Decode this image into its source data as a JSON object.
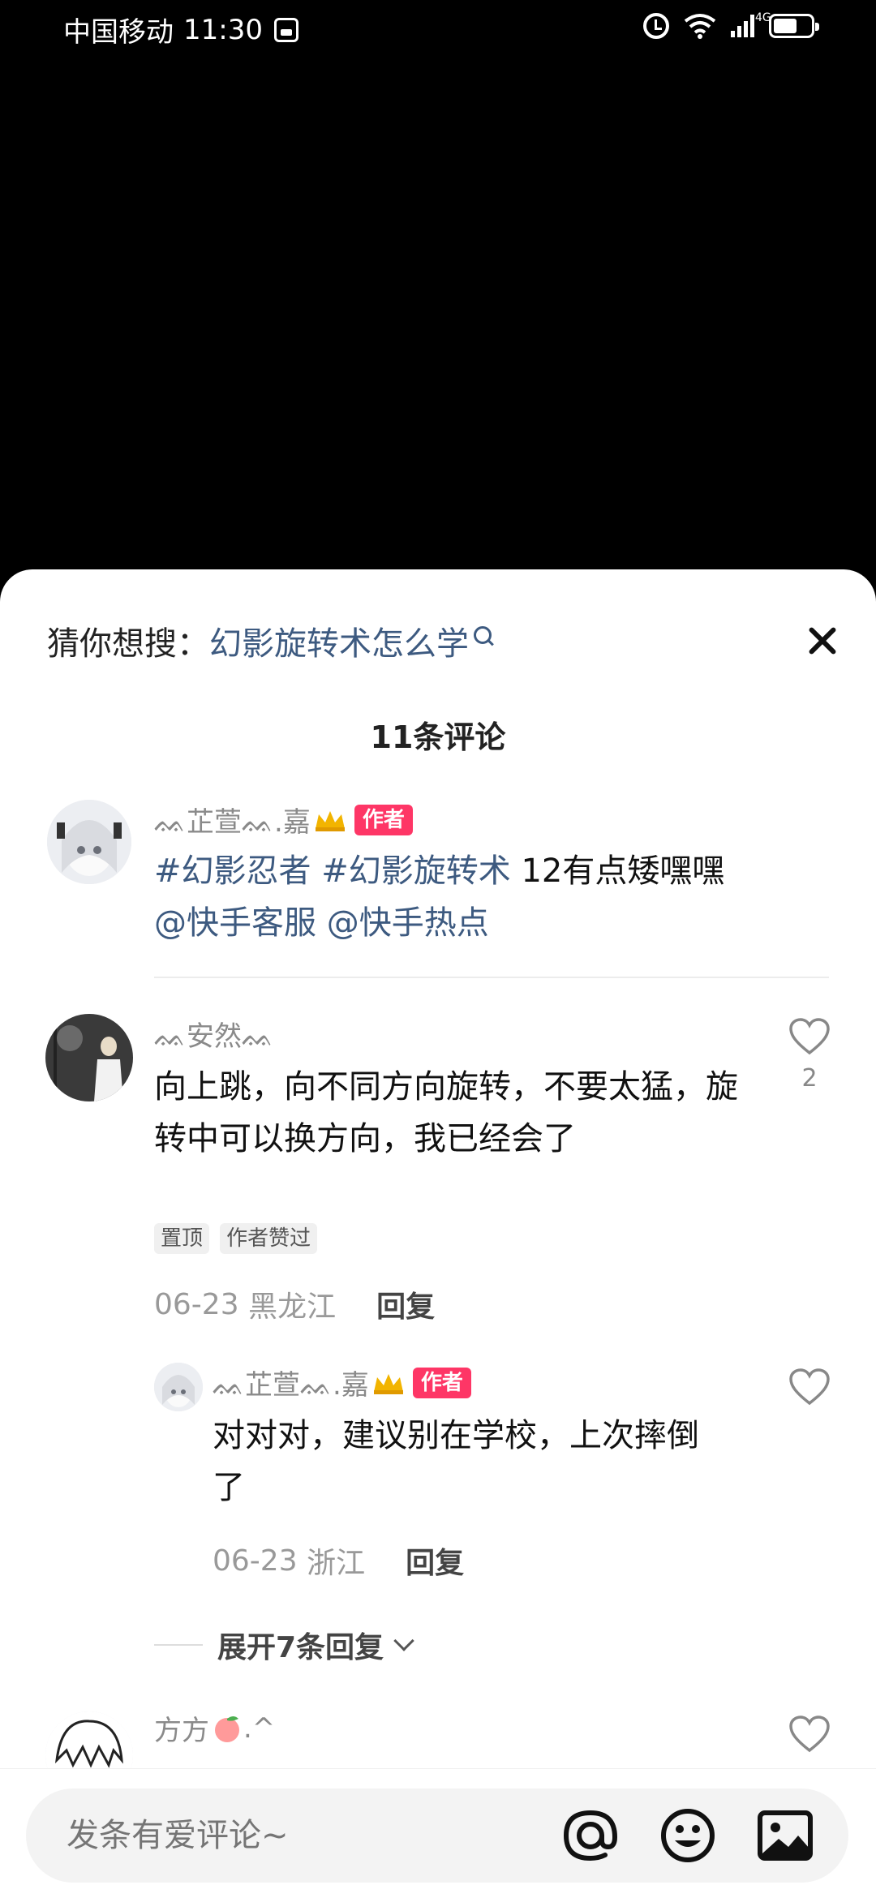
{
  "status_bar": {
    "carrier": "中国移动",
    "time": "11:30",
    "network": "4G",
    "icons": [
      "sim-icon",
      "alarm-icon",
      "wifi-icon",
      "signal-icon",
      "battery-icon"
    ]
  },
  "search_suggestion": {
    "label": "猜你想搜：",
    "term": "幻影旋转术怎么学"
  },
  "comments_header": {
    "title": "11条评论"
  },
  "post": {
    "nickname": "ᨐ芷萱ᨐ.嘉",
    "badge": "作者",
    "topic1": "#幻影忍者",
    "topic2": "#幻影旋转术",
    "text": " 12有点矮嘿嘿",
    "mention1": "@快手客服",
    "mention2": "@快手热点"
  },
  "comments": [
    {
      "nickname": "ᨐ安然ᨐ",
      "text": "向上跳，向不同方向旋转，不要太猛，旋转中可以换方向，我已经会了",
      "tag1": "置顶",
      "tag2": "作者赞过",
      "date": "06-23",
      "location": "黑龙江",
      "reply_label": "回复",
      "likes": "2"
    }
  ],
  "reply": {
    "nickname": "ᨐ芷萱ᨐ.嘉",
    "badge": "作者",
    "text": "对对对，建议别在学校，上次摔倒了",
    "date": "06-23",
    "location": "浙江",
    "reply_label": "回复"
  },
  "expand": {
    "label": "展开7条回复"
  },
  "next_comment": {
    "nickname": "方方",
    "suffix": ".^"
  },
  "input": {
    "placeholder": "发条有爱评论~"
  },
  "colors": {
    "accent": "#fe3666",
    "link": "#3d5a80"
  }
}
